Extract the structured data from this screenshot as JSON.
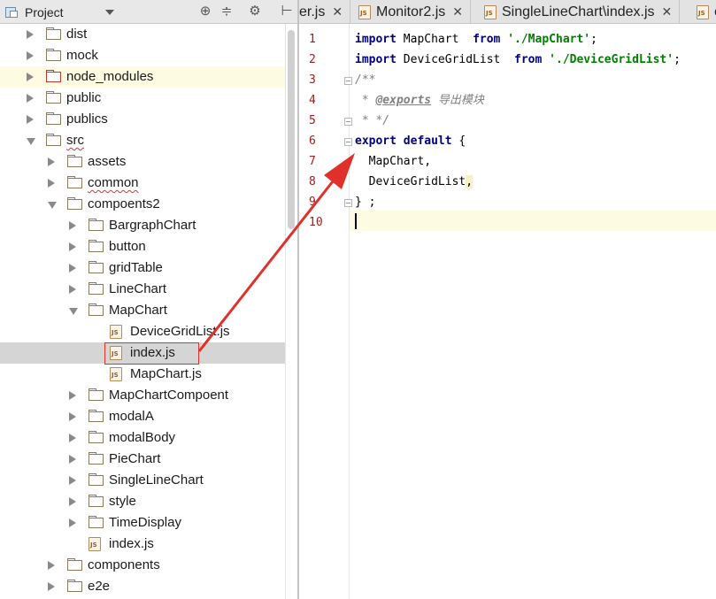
{
  "project_panel": {
    "title": "Project",
    "tool_icons": [
      "target-icon",
      "collapse-all-icon",
      "gear-icon",
      "hide-panel-icon"
    ]
  },
  "tree": [
    {
      "label": "dist",
      "kind": "folder",
      "depth": 1,
      "expanded": false
    },
    {
      "label": "mock",
      "kind": "folder",
      "depth": 1,
      "expanded": false
    },
    {
      "label": "node_modules",
      "kind": "folder-excluded",
      "depth": 1,
      "expanded": false
    },
    {
      "label": "public",
      "kind": "folder",
      "depth": 1,
      "expanded": false
    },
    {
      "label": "publics",
      "kind": "folder",
      "depth": 1,
      "expanded": false
    },
    {
      "label": "src",
      "kind": "folder",
      "depth": 1,
      "expanded": true
    },
    {
      "label": "assets",
      "kind": "folder",
      "depth": 2,
      "expanded": false
    },
    {
      "label": "common",
      "kind": "folder",
      "depth": 2,
      "expanded": false
    },
    {
      "label": "compoents2",
      "kind": "folder",
      "depth": 2,
      "expanded": true
    },
    {
      "label": "BargraphChart",
      "kind": "folder",
      "depth": 3,
      "expanded": false
    },
    {
      "label": "button",
      "kind": "folder",
      "depth": 3,
      "expanded": false
    },
    {
      "label": "gridTable",
      "kind": "folder",
      "depth": 3,
      "expanded": false
    },
    {
      "label": "LineChart",
      "kind": "folder",
      "depth": 3,
      "expanded": false
    },
    {
      "label": "MapChart",
      "kind": "folder",
      "depth": 3,
      "expanded": true
    },
    {
      "label": "DeviceGridList.js",
      "kind": "js",
      "depth": 4
    },
    {
      "label": "index.js",
      "kind": "js",
      "depth": 4,
      "selected": true
    },
    {
      "label": "MapChart.js",
      "kind": "js",
      "depth": 4
    },
    {
      "label": "MapChartCompoent",
      "kind": "folder",
      "depth": 3,
      "expanded": false
    },
    {
      "label": "modalA",
      "kind": "folder",
      "depth": 3,
      "expanded": false
    },
    {
      "label": "modalBody",
      "kind": "folder",
      "depth": 3,
      "expanded": false
    },
    {
      "label": "PieChart",
      "kind": "folder",
      "depth": 3,
      "expanded": false
    },
    {
      "label": "SingleLineChart",
      "kind": "folder",
      "depth": 3,
      "expanded": false
    },
    {
      "label": "style",
      "kind": "folder",
      "depth": 3,
      "expanded": false
    },
    {
      "label": "TimeDisplay",
      "kind": "folder",
      "depth": 3,
      "expanded": false
    },
    {
      "label": "index.js",
      "kind": "js",
      "depth": 3
    },
    {
      "label": "components",
      "kind": "folder",
      "depth": 2,
      "expanded": false
    },
    {
      "label": "e2e",
      "kind": "folder",
      "depth": 2,
      "expanded": false
    }
  ],
  "tabs": [
    {
      "label": "er.js",
      "close": "✕"
    },
    {
      "label": "Monitor2.js",
      "close": "✕"
    },
    {
      "label": "SingleLineChart\\index.js",
      "close": "✕"
    },
    {
      "label": "c",
      "close": ""
    }
  ],
  "editor": {
    "line_numbers": [
      "1",
      "2",
      "3",
      "4",
      "5",
      "6",
      "7",
      "8",
      "9",
      "10"
    ],
    "lines": [
      [
        {
          "t": "import",
          "c": "kw"
        },
        {
          "t": " MapChart  "
        },
        {
          "t": "from",
          "c": "kw"
        },
        {
          "t": " "
        },
        {
          "t": "'./MapChart'",
          "c": "str"
        },
        {
          "t": ";"
        }
      ],
      [
        {
          "t": "import",
          "c": "kw"
        },
        {
          "t": " DeviceGridList  "
        },
        {
          "t": "from",
          "c": "kw"
        },
        {
          "t": " "
        },
        {
          "t": "'./DeviceGridList'",
          "c": "str"
        },
        {
          "t": ";"
        }
      ],
      [
        {
          "t": "/**",
          "c": "cm"
        }
      ],
      [
        {
          "t": " * ",
          "c": "cm"
        },
        {
          "t": "@exports",
          "c": "tag"
        },
        {
          "t": " 导出模块",
          "c": "cm"
        }
      ],
      [
        {
          "t": " * */",
          "c": "cm"
        }
      ],
      [
        {
          "t": "export",
          "c": "kw"
        },
        {
          "t": " "
        },
        {
          "t": "default",
          "c": "kw"
        },
        {
          "t": " {"
        }
      ],
      [
        {
          "t": "  MapChart,"
        }
      ],
      [
        {
          "t": "  DeviceGridList"
        },
        {
          "t": ",",
          "c": "punc-hl"
        }
      ],
      [
        {
          "t": "} ;"
        }
      ],
      []
    ]
  },
  "colors": {
    "annotation_red": "#e0302a",
    "current_line": "#fdfbe2",
    "keyword": "#000080",
    "string": "#008000",
    "comment": "#808080"
  }
}
